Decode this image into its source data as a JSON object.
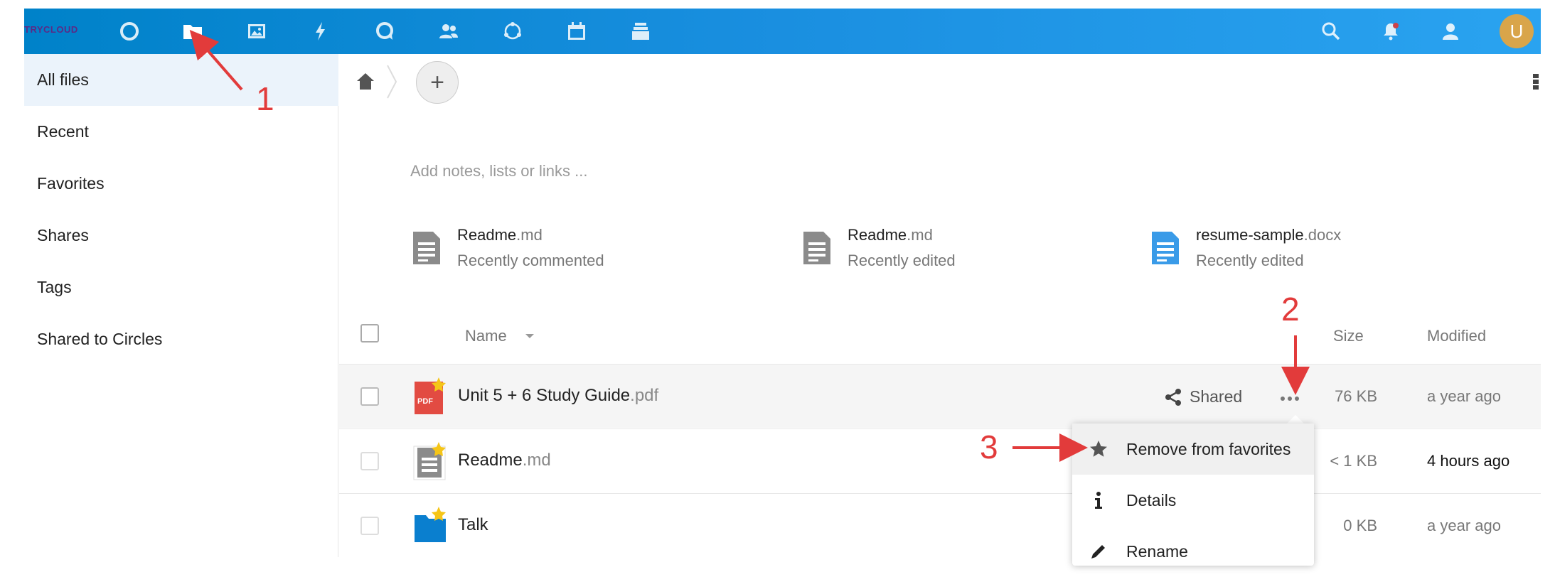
{
  "app": {
    "logo_text": "TRYCLOUD",
    "avatar_letter": "U"
  },
  "topbar": {
    "apps": [
      "dashboard-icon",
      "files-icon",
      "photos-icon",
      "activity-icon",
      "talk-icon",
      "contacts-icon",
      "circles-icon",
      "calendar-icon",
      "deck-icon"
    ],
    "right_icons": [
      "search-icon",
      "notifications-icon",
      "contacts-menu-icon"
    ],
    "colors": {
      "bar_start": "#0082c9",
      "bar_end": "#2aa3f0",
      "avatar": "#d9a54a"
    }
  },
  "sidebar": {
    "items": [
      {
        "label": "All files",
        "active": true
      },
      {
        "label": "Recent"
      },
      {
        "label": "Favorites"
      },
      {
        "label": "Shares"
      },
      {
        "label": "Tags"
      },
      {
        "label": "Shared to Circles"
      }
    ]
  },
  "main": {
    "add_button": "+",
    "notes_placeholder": "Add notes, lists or links ...",
    "recent": [
      {
        "name": "Readme",
        "ext": ".md",
        "sub": "Recently commented",
        "icon": "document-icon"
      },
      {
        "name": "Readme",
        "ext": ".md",
        "sub": "Recently edited",
        "icon": "document-icon"
      },
      {
        "name": "resume-sample",
        "ext": ".docx",
        "sub": "Recently edited",
        "icon": "word-document-icon"
      }
    ],
    "list_header": {
      "name": "Name",
      "size": "Size",
      "modified": "Modified"
    },
    "files": [
      {
        "name": "Unit 5 + 6 Study Guide",
        "ext": ".pdf",
        "pdf_label": "PDF",
        "shared": "Shared",
        "size": "76 KB",
        "modified": "a year ago"
      },
      {
        "name": "Readme",
        "ext": ".md",
        "size": "< 1 KB",
        "modified": "4 hours ago"
      },
      {
        "name": "Talk",
        "ext": "",
        "size": "0 KB",
        "modified": "a year ago"
      }
    ]
  },
  "menu": {
    "items": [
      {
        "label": "Remove from favorites",
        "icon": "star-icon"
      },
      {
        "label": "Details",
        "icon": "info-icon"
      },
      {
        "label": "Rename",
        "icon": "pencil-icon"
      }
    ]
  },
  "annotations": {
    "one": "1",
    "two": "2",
    "three": "3",
    "color": "#e23b3b"
  }
}
